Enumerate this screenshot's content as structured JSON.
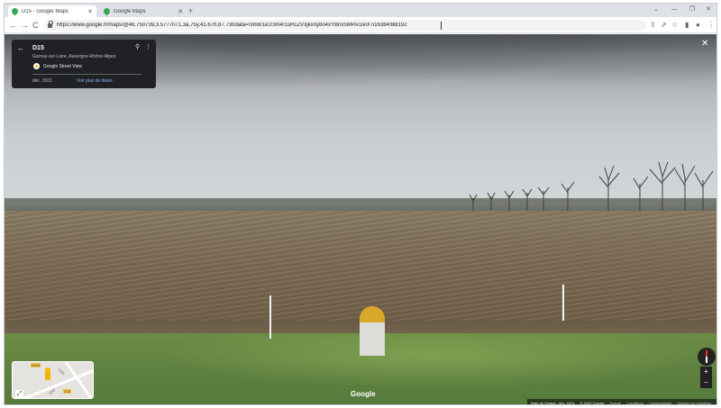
{
  "browser": {
    "tabs": [
      {
        "title": "D15 - Google Maps",
        "active": true
      },
      {
        "title": "Google Maps",
        "active": false
      }
    ],
    "new_tab": "+",
    "window_controls": [
      "⌄",
      "—",
      "❐",
      "✕"
    ],
    "nav": {
      "back": "←",
      "forward": "→",
      "reload": "C"
    },
    "url": "https://www.google.fr/maps/@46.750739,3.5777071,3a,75y,41.67h,87.73t/data=!3m6!1e1!3m4!1sRcZV3jkxny8o4xYBnx5MPA!2e0!7i16384!8i8192",
    "toolbar_icons": [
      "⇪",
      "⇗",
      "☆",
      "▮",
      "●",
      "⋮"
    ]
  },
  "streetview": {
    "info": {
      "back": "←",
      "road": "D15",
      "place": "Garnay-sur-Loire, Auvergne-Rhône-Alpes",
      "source": "Google Street View",
      "date": "déc. 2021",
      "more_dates": "Voir plus de dates",
      "pin": "⚲",
      "menu": "⋮"
    },
    "close": "✕",
    "minimap": {
      "label1": "D116",
      "label2": "D15",
      "road_label1": "Loire",
      "road_label2": "D15",
      "expand": "⤢"
    },
    "logo": "Google",
    "zoom_in": "+",
    "zoom_out": "−",
    "footer": {
      "image_date": "Date de l'image : déc. 2021",
      "copyright": "© 2022 Google",
      "links": [
        "France",
        "Conditions",
        "Confidentialité",
        "Signaler un problème"
      ]
    }
  },
  "colors": {
    "tabstrip": "#dee1e6",
    "info_card": "#202124",
    "link": "#8ab4f8",
    "milestone_cap": "#d9a82a"
  }
}
